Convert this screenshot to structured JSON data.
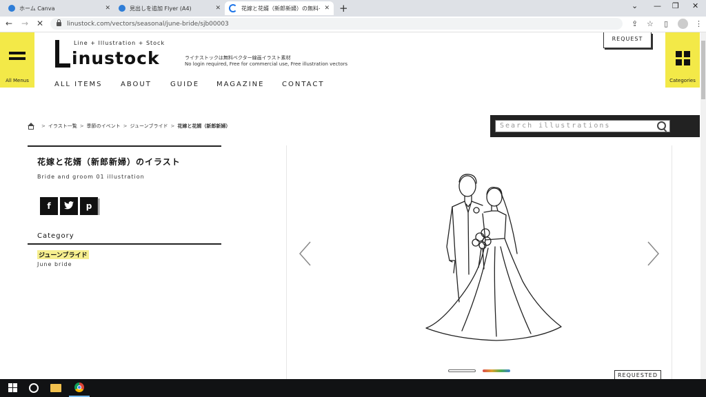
{
  "browser": {
    "tabs": [
      {
        "title": "ホーム  Canva",
        "active": false
      },
      {
        "title": "見出しを追加 Flyer (A4)",
        "active": false
      },
      {
        "title": "花嫁と花婿（新郎新婦）の無料イ",
        "active": true
      }
    ],
    "url": "linustock.com/vectors/seasonal/june-bride/sjb00003"
  },
  "site": {
    "logo_text": "inustock",
    "logo_sub": "Line + Illustration + Stock",
    "tagline_jp": "ライナストックは無料ベクター線画イラスト素材",
    "tagline_en": "No login required, Free for commercial use, Free illustration vectors",
    "request_label": "REQUEST",
    "all_menus_label": "All Menus",
    "categories_label": "Categories",
    "nav": [
      "ALL ITEMS",
      "ABOUT",
      "GUIDE",
      "MAGAZINE",
      "CONTACT"
    ]
  },
  "breadcrumb": [
    "イラスト一覧",
    "季節のイベント",
    "ジューンブライド",
    "花嫁と花婿（新郎新婦）"
  ],
  "search": {
    "placeholder": "Search illustrations"
  },
  "item": {
    "title": "花嫁と花婿（新郎新婦）のイラスト",
    "subtitle": "Bride and groom 01 illustration",
    "category_heading": "Category",
    "category_tag": "ジューンブライド",
    "category_en": "June bride"
  },
  "share": [
    "f",
    "t",
    "p"
  ],
  "viewer": {
    "requested_label": "REQUESTED"
  },
  "colors": {
    "yellow": "#f3e948",
    "highlight": "#f6ee8e",
    "dark": "#222222"
  }
}
